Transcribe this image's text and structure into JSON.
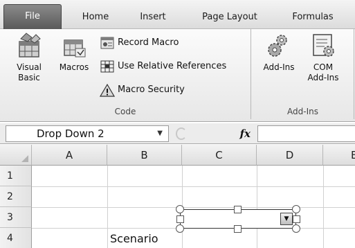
{
  "ribbon": {
    "tabs": [
      {
        "label": "File"
      },
      {
        "label": "Home"
      },
      {
        "label": "Insert"
      },
      {
        "label": "Page Layout"
      },
      {
        "label": "Formulas"
      }
    ],
    "code_group": {
      "label": "Code",
      "visual_basic": "Visual\nBasic",
      "visual_basic_l1": "Visual",
      "visual_basic_l2": "Basic",
      "macros": "Macros",
      "record_macro": "Record Macro",
      "relative_references": "Use Relative References",
      "macro_security": "Macro Security"
    },
    "addins_group": {
      "label": "Add-Ins",
      "addins": "Add-Ins",
      "com_l1": "COM",
      "com_l2": "Add-Ins"
    }
  },
  "formula_bar": {
    "name_box": "Drop Down 2",
    "fx": "fx",
    "formula": ""
  },
  "sheet": {
    "columns": [
      "A",
      "B",
      "C",
      "D",
      "E"
    ],
    "rows": [
      "1",
      "2",
      "3",
      "4"
    ],
    "cells": {
      "B3": "Scenario"
    }
  },
  "form_control": {
    "type": "dropdown",
    "selected": ""
  }
}
